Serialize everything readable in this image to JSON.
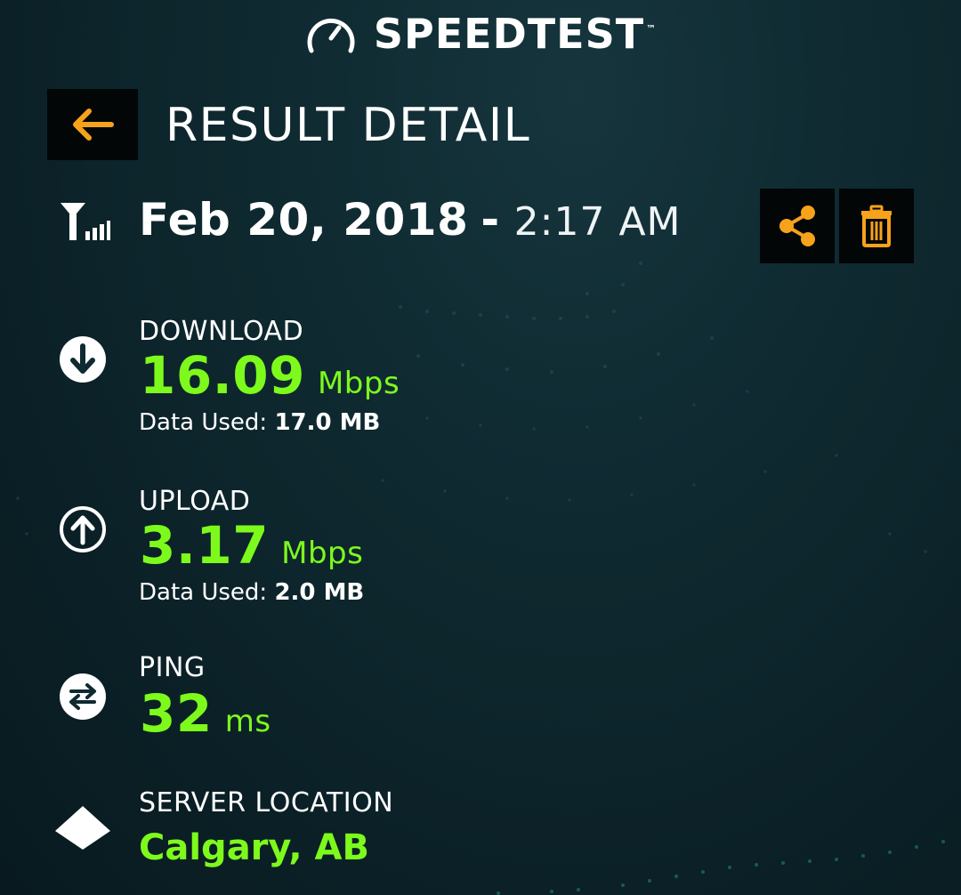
{
  "brand": {
    "name": "SPEEDTEST",
    "trademark": "™"
  },
  "header": {
    "title": "RESULT DETAIL",
    "back_icon": "arrow-left-icon"
  },
  "result": {
    "date": "Feb 20, 2018",
    "separator": "-",
    "time": "2:17 AM",
    "connection_icon": "cellular-signal-icon",
    "actions": {
      "share_icon": "share-icon",
      "delete_icon": "trash-icon"
    }
  },
  "metrics": {
    "download": {
      "label": "DOWNLOAD",
      "value": "16.09",
      "unit": "Mbps",
      "data_used_label": "Data Used:",
      "data_used_value": "17.0 MB",
      "icon": "download-arrow-icon"
    },
    "upload": {
      "label": "UPLOAD",
      "value": "3.17",
      "unit": "Mbps",
      "data_used_label": "Data Used:",
      "data_used_value": "2.0 MB",
      "icon": "upload-arrow-icon"
    },
    "ping": {
      "label": "PING",
      "value": "32",
      "unit": "ms",
      "icon": "ping-arrows-icon"
    },
    "server": {
      "label": "SERVER LOCATION",
      "value": "Calgary, AB",
      "icon": "server-pyramid-icon"
    }
  },
  "colors": {
    "accent_orange": "#f7a21b",
    "value_green": "#7dfa1c",
    "background": "#0f2a31",
    "button_bg": "#020607"
  }
}
